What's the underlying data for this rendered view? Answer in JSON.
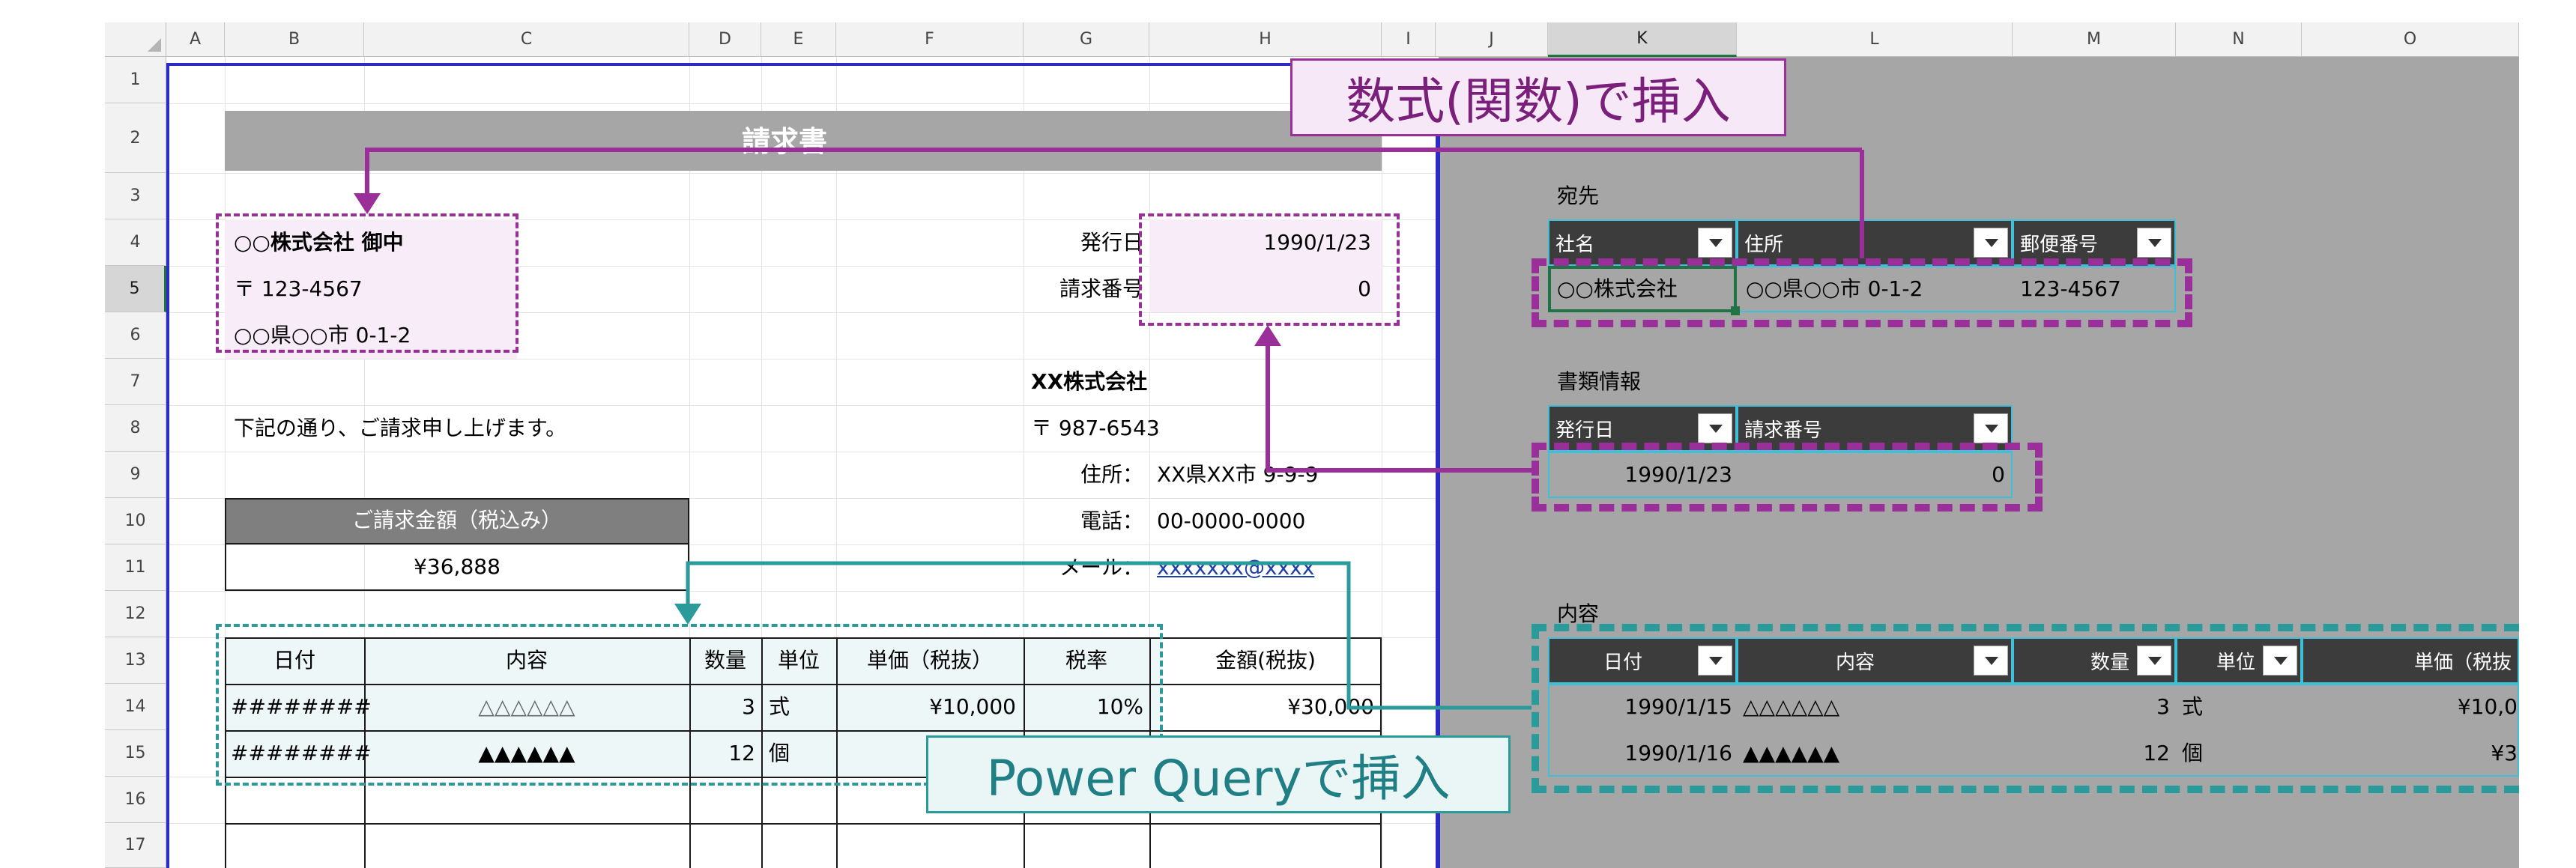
{
  "columns": [
    "A",
    "B",
    "C",
    "D",
    "E",
    "F",
    "G",
    "H",
    "I",
    "J",
    "K",
    "L",
    "M",
    "N",
    "O"
  ],
  "rows": [
    "1",
    "2",
    "3",
    "4",
    "5",
    "6",
    "7",
    "8",
    "9",
    "10",
    "11",
    "12",
    "13",
    "14",
    "15",
    "16",
    "17"
  ],
  "invoice": {
    "title": "請求書",
    "recipient_company": "○○株式会社 御中",
    "recipient_zip": "〒 123-4567",
    "recipient_address": "○○県○○市 0-1-2",
    "issue_date_label": "発行日",
    "issue_date": "1990/1/23",
    "invoice_no_label": "請求番号",
    "invoice_no": "0",
    "sender_company": "XX株式会社",
    "sender_zip": "〒 987-6543",
    "address_label": "住所：",
    "address": "XX県XX市 9-9-9",
    "phone_label": "電話：",
    "phone": "00-0000-0000",
    "mail_label": "メール：",
    "mail": "xxxxxxx@xxxx",
    "greeting": "下記の通り、ご請求申し上げます。",
    "total_label": "ご請求金額（税込み）",
    "total": "¥36,888",
    "table_headers": [
      "日付",
      "内容",
      "数量",
      "単位",
      "単価（税抜）",
      "税率",
      "金額(税抜)"
    ],
    "table_rows": [
      [
        "########",
        "△△△△△△",
        "3",
        "式",
        "¥10,000",
        "10%",
        "¥30,000"
      ],
      [
        "########",
        "▲▲▲▲▲▲",
        "12",
        "個",
        "",
        "",
        ""
      ]
    ]
  },
  "right": {
    "dest_label": "宛先",
    "dest_headers": [
      "社名",
      "住所",
      "郵便番号"
    ],
    "dest_row": [
      "○○株式会社",
      "○○県○○市 0-1-2",
      "123-4567"
    ],
    "doc_label": "書類情報",
    "doc_headers": [
      "発行日",
      "請求番号"
    ],
    "doc_row": [
      "1990/1/23",
      "0"
    ],
    "content_label": "内容",
    "content_headers": [
      "日付",
      "内容",
      "数量",
      "単位",
      "単価（税抜"
    ],
    "content_rows": [
      [
        "1990/1/15",
        "△△△△△△",
        "3",
        "式",
        "¥10,0"
      ],
      [
        "1990/1/16",
        "▲▲▲▲▲▲",
        "12",
        "個",
        "¥3"
      ]
    ]
  },
  "callouts": {
    "formula": "数式(関数)で挿入",
    "power_query": "Power Queryで挿入"
  },
  "colors": {
    "purple": "#9a2f9a",
    "teal": "#2a9a9a",
    "gray_area": "#a6a6a6",
    "header_dark": "#3c3c3c"
  }
}
